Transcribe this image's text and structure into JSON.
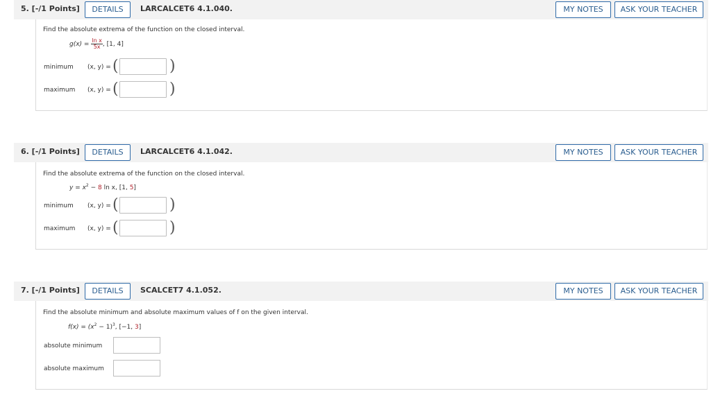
{
  "common": {
    "details_label": "DETAILS",
    "my_notes_label": "MY NOTES",
    "ask_teacher_label": "ASK YOUR TEACHER"
  },
  "q5": {
    "number": "5. [-/1 Points]",
    "id": "LARCALCET6 4.1.040.",
    "prompt": "Find the absolute extrema of the function on the closed interval.",
    "func_prefix": "g(x) =",
    "frac_num": "ln x",
    "frac_den": "5x",
    "interval": ", [1, 4]",
    "row1_label": "minimum",
    "row2_label": "maximum",
    "xy_label": "(x, y) =",
    "min_value": "",
    "max_value": ""
  },
  "q6": {
    "number": "6. [-/1 Points]",
    "id": "LARCALCET6 4.1.042.",
    "prompt": "Find the absolute extrema of the function on the closed interval.",
    "func_a": "y = x",
    "func_sup": "2",
    "func_b": " − ",
    "func_red": "8",
    "func_c": " ln x, [1, ",
    "func_red2": "5",
    "func_d": "]",
    "row1_label": "minimum",
    "row2_label": "maximum",
    "xy_label": "(x, y) =",
    "min_value": "",
    "max_value": ""
  },
  "q7": {
    "number": "7. [-/1 Points]",
    "id": "SCALCET7 4.1.052.",
    "prompt": "Find the absolute minimum and absolute maximum values of f on the given interval.",
    "func_a": "f(x) = (x",
    "func_sup": "2",
    "func_b": " − 1)",
    "func_sup2": "3",
    "func_c": ",    [−1, ",
    "func_red": "3",
    "func_d": "]",
    "row1_label": "absolute minimum",
    "row2_label": "absolute maximum",
    "min_value": "",
    "max_value": ""
  }
}
